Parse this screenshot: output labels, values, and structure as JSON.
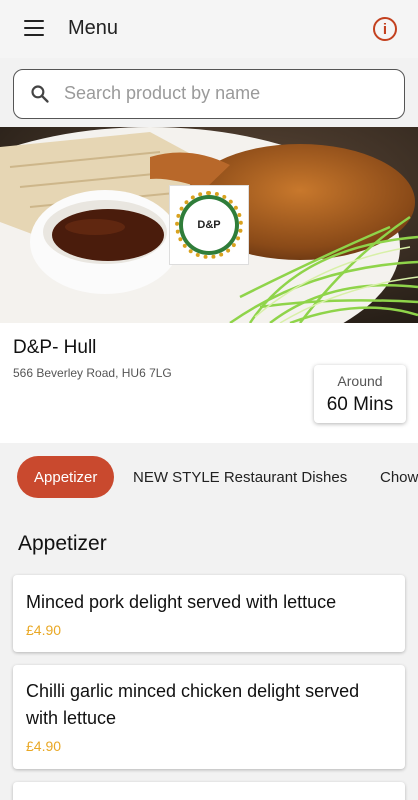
{
  "header": {
    "title": "Menu",
    "menu_icon": "hamburger-menu-icon",
    "info_icon": "info-icon"
  },
  "search": {
    "placeholder": "Search product by name",
    "icon": "search-icon"
  },
  "shop": {
    "name": "D&P- Hull",
    "address": "566 Beverley Road, HU6 7LG",
    "delivery_label": "Around",
    "delivery_time": "60  Mins",
    "logo_text": "D&P"
  },
  "categories": [
    {
      "label": "Appetizer",
      "active": true
    },
    {
      "label": "NEW STYLE Restaurant Dishes",
      "active": false
    },
    {
      "label": "Chow",
      "active": false
    }
  ],
  "section": {
    "title": "Appetizer"
  },
  "products": [
    {
      "name": "Minced pork delight served with lettuce",
      "price": "£4.90"
    },
    {
      "name": "Chilli garlic minced chicken delight served with  lettuce",
      "price": "£4.90"
    }
  ],
  "colors": {
    "accent": "#c9492e",
    "price": "#e9a825",
    "info": "#c3411f"
  }
}
